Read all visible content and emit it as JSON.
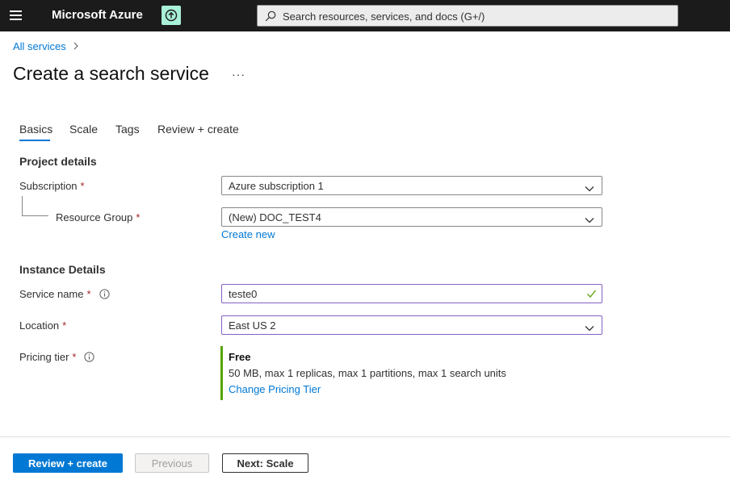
{
  "topbar": {
    "brand": "Microsoft Azure",
    "search_placeholder": "Search resources, services, and docs (G+/)"
  },
  "breadcrumb": {
    "item": "All services"
  },
  "page": {
    "title": "Create a search service",
    "more": "···"
  },
  "tabs": [
    {
      "label": "Basics",
      "active": true
    },
    {
      "label": "Scale"
    },
    {
      "label": "Tags"
    },
    {
      "label": "Review + create"
    }
  ],
  "project": {
    "heading": "Project details",
    "subscription_label": "Subscription",
    "subscription_value": "Azure subscription 1",
    "resource_group_label": "Resource Group",
    "resource_group_value": "(New) DOC_TEST4",
    "create_new": "Create new"
  },
  "instance": {
    "heading": "Instance Details",
    "service_name_label": "Service name",
    "service_name_value": "teste0",
    "location_label": "Location",
    "location_value": "East US 2",
    "pricing_label": "Pricing tier",
    "tier_name": "Free",
    "tier_desc": "50 MB, max 1 replicas, max 1 partitions, max 1 search units",
    "change_tier": "Change Pricing Tier"
  },
  "required_mark": "*",
  "footer": {
    "review_create": "Review + create",
    "previous": "Previous",
    "next": "Next: Scale"
  },
  "colors": {
    "accent": "#0078d4",
    "required": "#a4262c",
    "tier_bar": "#57a300",
    "valid_check": "#57a300",
    "focus_border": "#8661c5"
  }
}
